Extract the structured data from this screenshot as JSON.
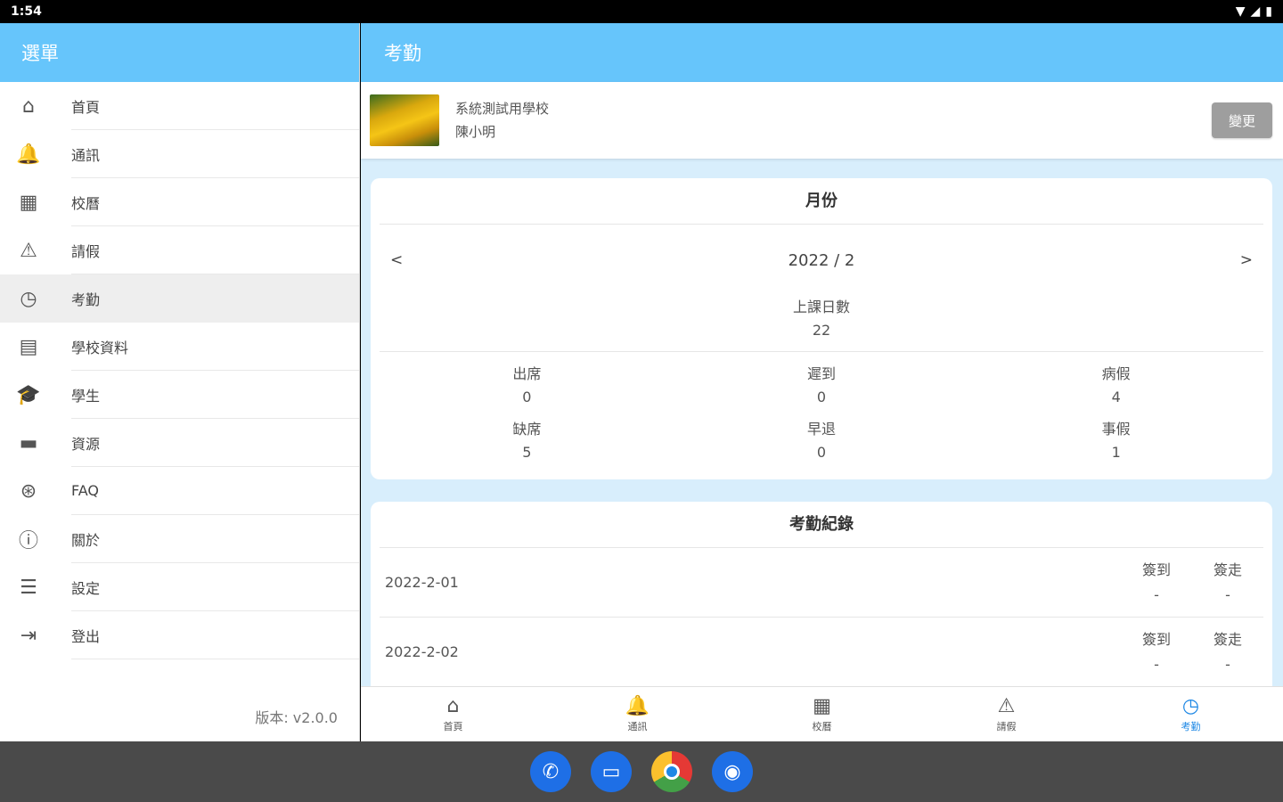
{
  "statusbar": {
    "time": "1:54",
    "icons": [
      "wifi-icon",
      "signal-icon",
      "battery-icon"
    ]
  },
  "drawer": {
    "title": "選單",
    "items": [
      {
        "label": "首頁",
        "icon": "home-icon",
        "glyph": "⌂"
      },
      {
        "label": "通訊",
        "icon": "bell-icon",
        "glyph": "🔔"
      },
      {
        "label": "校曆",
        "icon": "calendar-icon",
        "glyph": "▦"
      },
      {
        "label": "請假",
        "icon": "warning-icon",
        "glyph": "⚠"
      },
      {
        "label": "考勤",
        "icon": "clock-icon",
        "glyph": "◷"
      },
      {
        "label": "學校資料",
        "icon": "school-icon",
        "glyph": "▤"
      },
      {
        "label": "學生",
        "icon": "graduation-cap-icon",
        "glyph": "🎓"
      },
      {
        "label": "資源",
        "icon": "folder-icon",
        "glyph": "▬"
      },
      {
        "label": "FAQ",
        "icon": "lifebuoy-icon",
        "glyph": "⊛"
      },
      {
        "label": "關於",
        "icon": "info-icon",
        "glyph": "ⓘ"
      },
      {
        "label": "設定",
        "icon": "sliders-icon",
        "glyph": "☰"
      },
      {
        "label": "登出",
        "icon": "logout-icon",
        "glyph": "⇥"
      }
    ],
    "active_index": 4,
    "version": "版本: v2.0.0"
  },
  "main": {
    "title": "考勤",
    "user": {
      "school": "系統測試用學校",
      "name": "陳小明",
      "change_label": "變更"
    },
    "month_card": {
      "title": "月份",
      "prev": "<",
      "month": "2022 / 2",
      "next": ">",
      "school_days_label": "上課日數",
      "school_days": "22",
      "stats": [
        {
          "label": "出席",
          "value": "0"
        },
        {
          "label": "遲到",
          "value": "0"
        },
        {
          "label": "病假",
          "value": "4"
        },
        {
          "label": "缺席",
          "value": "5"
        },
        {
          "label": "早退",
          "value": "0"
        },
        {
          "label": "事假",
          "value": "1"
        }
      ]
    },
    "records_card": {
      "title": "考勤紀錄",
      "records": [
        {
          "date": "2022-2-01",
          "in_label": "簽到",
          "in_value": "-",
          "out_label": "簽走",
          "out_value": "-"
        },
        {
          "date": "2022-2-02",
          "in_label": "簽到",
          "in_value": "-",
          "out_label": "簽走",
          "out_value": "-"
        }
      ]
    },
    "bottom_nav": [
      {
        "label": "首頁",
        "icon": "home-icon",
        "glyph": "⌂"
      },
      {
        "label": "通訊",
        "icon": "bell-icon",
        "glyph": "🔔"
      },
      {
        "label": "校曆",
        "icon": "calendar-icon",
        "glyph": "▦"
      },
      {
        "label": "請假",
        "icon": "warning-icon",
        "glyph": "⚠"
      },
      {
        "label": "考勤",
        "icon": "clock-icon",
        "glyph": "◷"
      }
    ],
    "active_nav": 4
  },
  "colors": {
    "header": "#66c5fb",
    "active_nav": "#1e88e5",
    "background": "#d8eefc"
  }
}
